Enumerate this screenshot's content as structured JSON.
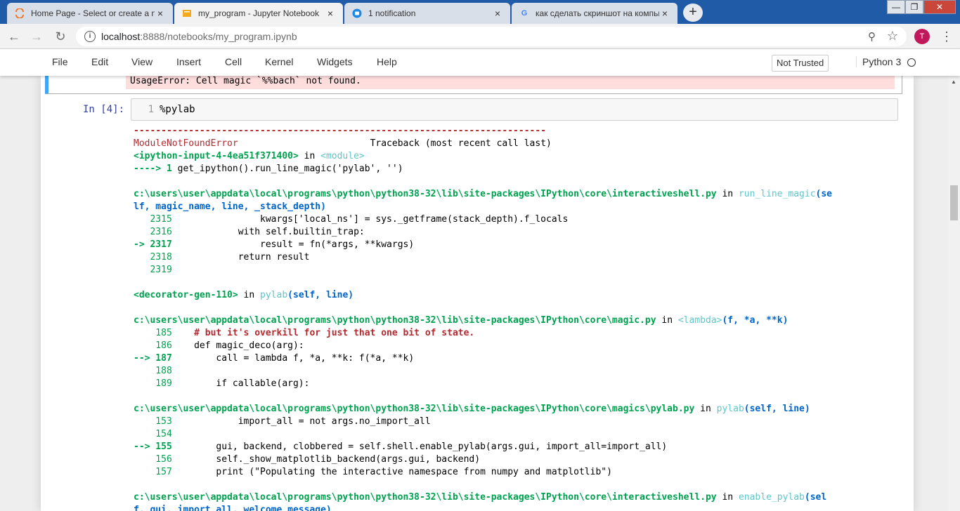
{
  "browser": {
    "tabs": [
      {
        "title": "Home Page - Select or create a notebook",
        "icon": "jupyter-logo-icon",
        "active": false
      },
      {
        "title": "my_program - Jupyter Notebook",
        "icon": "notebook-icon",
        "active": true
      },
      {
        "title": "1 notification",
        "icon": "chat-icon",
        "active": false
      },
      {
        "title": "как сделать скриншот на компьютере",
        "icon": "google-icon",
        "active": false
      }
    ],
    "tab_close": "×",
    "new_tab": "+",
    "address": {
      "host": "localhost",
      "path": ":8888/notebooks/my_program.ipynb"
    },
    "avatar_letter": "T"
  },
  "menubar": {
    "items": [
      "File",
      "Edit",
      "View",
      "Insert",
      "Cell",
      "Kernel",
      "Widgets",
      "Help"
    ],
    "trusted": "Not Trusted",
    "kernel": "Python 3"
  },
  "prev_cell": {
    "error": "UsageError: Cell magic `%%bach` not found."
  },
  "cell": {
    "prompt": "In [4]:",
    "line_number": "1",
    "code": "%pylab"
  },
  "traceback": {
    "separator": "---------------------------------------------------------------------------",
    "error_name": "ModuleNotFoundError",
    "traceback_label": "Traceback (most recent call last)",
    "frame0": {
      "input": "<ipython-input-4-4ea51f371400>",
      "in": " in ",
      "module": "<module>"
    },
    "frame0_arrow": "----> 1 ",
    "frame0_code": "get_ipython().run_line_magic('pylab', '')",
    "frame1_path": "c:\\users\\user\\appdata\\local\\programs\\python\\python38-32\\lib\\site-packages\\IPython\\core\\interactiveshell.py",
    "frame1_func": "run_line_magic",
    "frame1_args_a": "(se",
    "frame1_args_b": "lf, magic_name, line, _stack_depth)",
    "frame1_lines": [
      {
        "no": "   2315",
        "code": "                kwargs['local_ns'] = sys._getframe(stack_depth).f_locals"
      },
      {
        "no": "   2316",
        "code": "            with self.builtin_trap:"
      },
      {
        "no": "-> 2317",
        "code": "                result = fn(*args, **kwargs)"
      },
      {
        "no": "   2318",
        "code": "            return result"
      },
      {
        "no": "   2319",
        "code": ""
      }
    ],
    "frame2_file": "<decorator-gen-110>",
    "frame2_func": "pylab",
    "frame2_args": "(self, line)",
    "frame3_path": "c:\\users\\user\\appdata\\local\\programs\\python\\python38-32\\lib\\site-packages\\IPython\\core\\magic.py",
    "frame3_func": "<lambda>",
    "frame3_args": "(f, *a, **k)",
    "frame3_lines": [
      {
        "no": "    185",
        "code": "    # but it's overkill for just that one bit of state."
      },
      {
        "no": "    186",
        "code": "    def magic_deco(arg):"
      },
      {
        "no": "--> 187",
        "code": "        call = lambda f, *a, **k: f(*a, **k)"
      },
      {
        "no": "    188",
        "code": ""
      },
      {
        "no": "    189",
        "code": "        if callable(arg):"
      }
    ],
    "frame4_path": "c:\\users\\user\\appdata\\local\\programs\\python\\python38-32\\lib\\site-packages\\IPython\\core\\magics\\pylab.py",
    "frame4_func": "pylab",
    "frame4_args": "(self, line)",
    "frame4_lines": [
      {
        "no": "    153",
        "code": "            import_all = not args.no_import_all"
      },
      {
        "no": "    154",
        "code": ""
      },
      {
        "no": "--> 155",
        "code": "        gui, backend, clobbered = self.shell.enable_pylab(args.gui, import_all=import_all)"
      },
      {
        "no": "    156",
        "code": "        self._show_matplotlib_backend(args.gui, backend)"
      },
      {
        "no": "    157",
        "code": "        print (\"Populating the interactive namespace from numpy and matplotlib\")"
      }
    ],
    "frame5_path": "c:\\users\\user\\appdata\\local\\programs\\python\\python38-32\\lib\\site-packages\\IPython\\core\\interactiveshell.py",
    "frame5_func": "enable_pylab",
    "frame5_args_a": "(sel",
    "frame5_args_b": "f, gui, import_all, welcome_message)"
  }
}
